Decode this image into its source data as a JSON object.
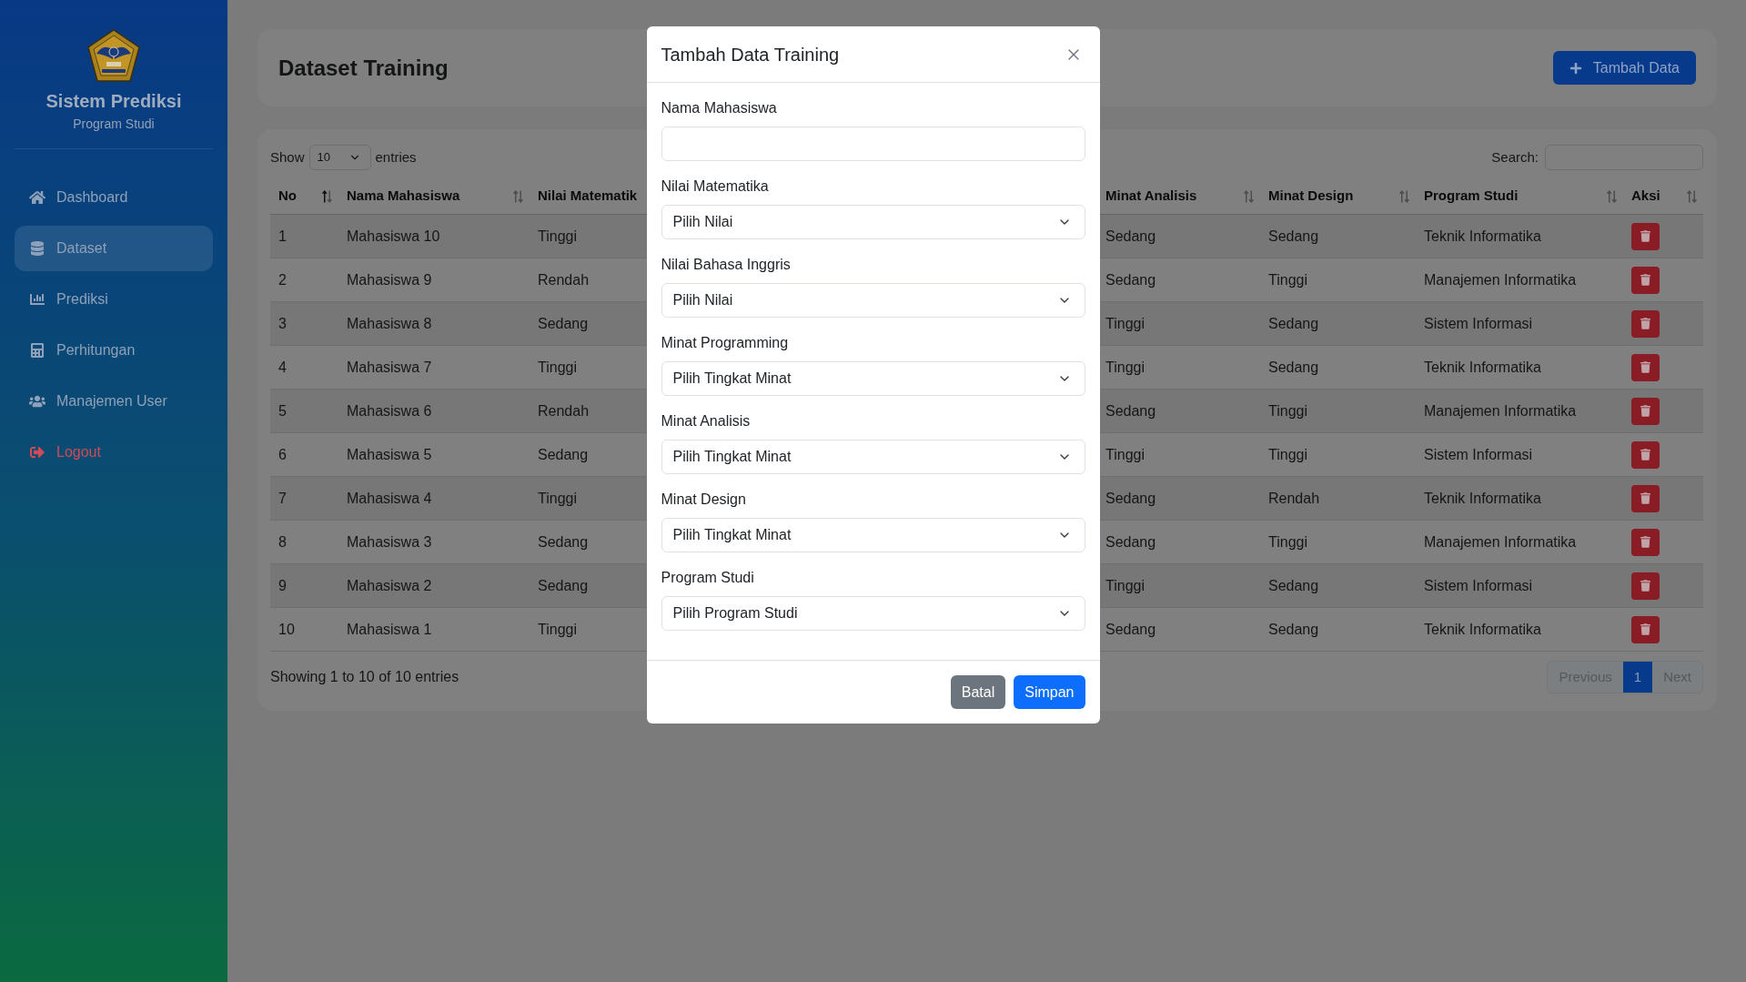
{
  "sidebar": {
    "title": "Sistem Prediksi",
    "subtitle": "Program Studi",
    "items": [
      {
        "label": "Dashboard",
        "kind": "link",
        "selected": false
      },
      {
        "label": "Dataset",
        "kind": "link",
        "selected": true
      },
      {
        "label": "Prediksi",
        "kind": "link",
        "selected": false
      },
      {
        "label": "Perhitungan",
        "kind": "link",
        "selected": false
      },
      {
        "label": "Manajemen User",
        "kind": "link",
        "selected": false
      },
      {
        "label": "Logout",
        "kind": "logout",
        "selected": false
      }
    ]
  },
  "header": {
    "title": "Dataset Training",
    "add_button": "Tambah Data"
  },
  "table": {
    "show_label": "Show",
    "page_size": "10",
    "entries_label": "entries",
    "search_label": "Search:",
    "columns": [
      {
        "label": "No",
        "kind": "text",
        "sort_icon": true,
        "sorted": true
      },
      {
        "label": "Nama Mahasiswa",
        "kind": "text",
        "sort_icon": true,
        "sorted": false
      },
      {
        "label": "Nilai Matematik",
        "kind": "text",
        "sort_icon": false
      },
      {
        "label": "Minat Analisis",
        "kind": "text",
        "sort_icon": true,
        "sorted": false
      },
      {
        "label": "Minat Design",
        "kind": "text",
        "sort_icon": true,
        "sorted": false
      },
      {
        "label": "Program Studi",
        "kind": "text",
        "sort_icon": true,
        "sorted": false
      },
      {
        "label": "Aksi",
        "kind": "action",
        "sort_icon": true,
        "sorted": false
      }
    ],
    "rows": [
      {
        "cells": [
          "1",
          "Mahasiswa 10",
          "Tinggi",
          "Sedang",
          "Sedang",
          "Teknik Informatika"
        ]
      },
      {
        "cells": [
          "2",
          "Mahasiswa 9",
          "Rendah",
          "Sedang",
          "Tinggi",
          "Manajemen Informatika"
        ]
      },
      {
        "cells": [
          "3",
          "Mahasiswa 8",
          "Sedang",
          "Tinggi",
          "Sedang",
          "Sistem Informasi"
        ]
      },
      {
        "cells": [
          "4",
          "Mahasiswa 7",
          "Tinggi",
          "Tinggi",
          "Sedang",
          "Teknik Informatika"
        ]
      },
      {
        "cells": [
          "5",
          "Mahasiswa 6",
          "Rendah",
          "Sedang",
          "Tinggi",
          "Manajemen Informatika"
        ]
      },
      {
        "cells": [
          "6",
          "Mahasiswa 5",
          "Sedang",
          "Tinggi",
          "Tinggi",
          "Sistem Informasi"
        ]
      },
      {
        "cells": [
          "7",
          "Mahasiswa 4",
          "Tinggi",
          "Sedang",
          "Rendah",
          "Teknik Informatika"
        ]
      },
      {
        "cells": [
          "8",
          "Mahasiswa 3",
          "Sedang",
          "Sedang",
          "Tinggi",
          "Manajemen Informatika"
        ]
      },
      {
        "cells": [
          "9",
          "Mahasiswa 2",
          "Sedang",
          "Tinggi",
          "Sedang",
          "Sistem Informasi"
        ]
      },
      {
        "cells": [
          "10",
          "Mahasiswa 1",
          "Tinggi",
          "Sedang",
          "Sedang",
          "Teknik Informatika"
        ]
      }
    ],
    "info": "Showing 1 to 10 of 10 entries",
    "pagination": [
      {
        "label": "Previous",
        "selected": false,
        "disabled": true
      },
      {
        "label": "1",
        "selected": true,
        "disabled": false
      },
      {
        "label": "Next",
        "selected": false,
        "disabled": true
      }
    ]
  },
  "modal": {
    "title": "Tambah Data Training",
    "fields": [
      {
        "label": "Nama Mahasiswa",
        "kind": "text"
      },
      {
        "label": "Nilai Matematika",
        "kind": "select",
        "value": "Pilih Nilai"
      },
      {
        "label": "Nilai Bahasa Inggris",
        "kind": "select",
        "value": "Pilih Nilai"
      },
      {
        "label": "Minat Programming",
        "kind": "select",
        "value": "Pilih Tingkat Minat"
      },
      {
        "label": "Minat Analisis",
        "kind": "select",
        "value": "Pilih Tingkat Minat"
      },
      {
        "label": "Minat Design",
        "kind": "select",
        "value": "Pilih Tingkat Minat"
      },
      {
        "label": "Program Studi",
        "kind": "select",
        "value": "Pilih Program Studi"
      }
    ],
    "buttons": [
      {
        "label": "Batal",
        "kind": "secondary"
      },
      {
        "label": "Simpan",
        "kind": "primary"
      }
    ]
  }
}
